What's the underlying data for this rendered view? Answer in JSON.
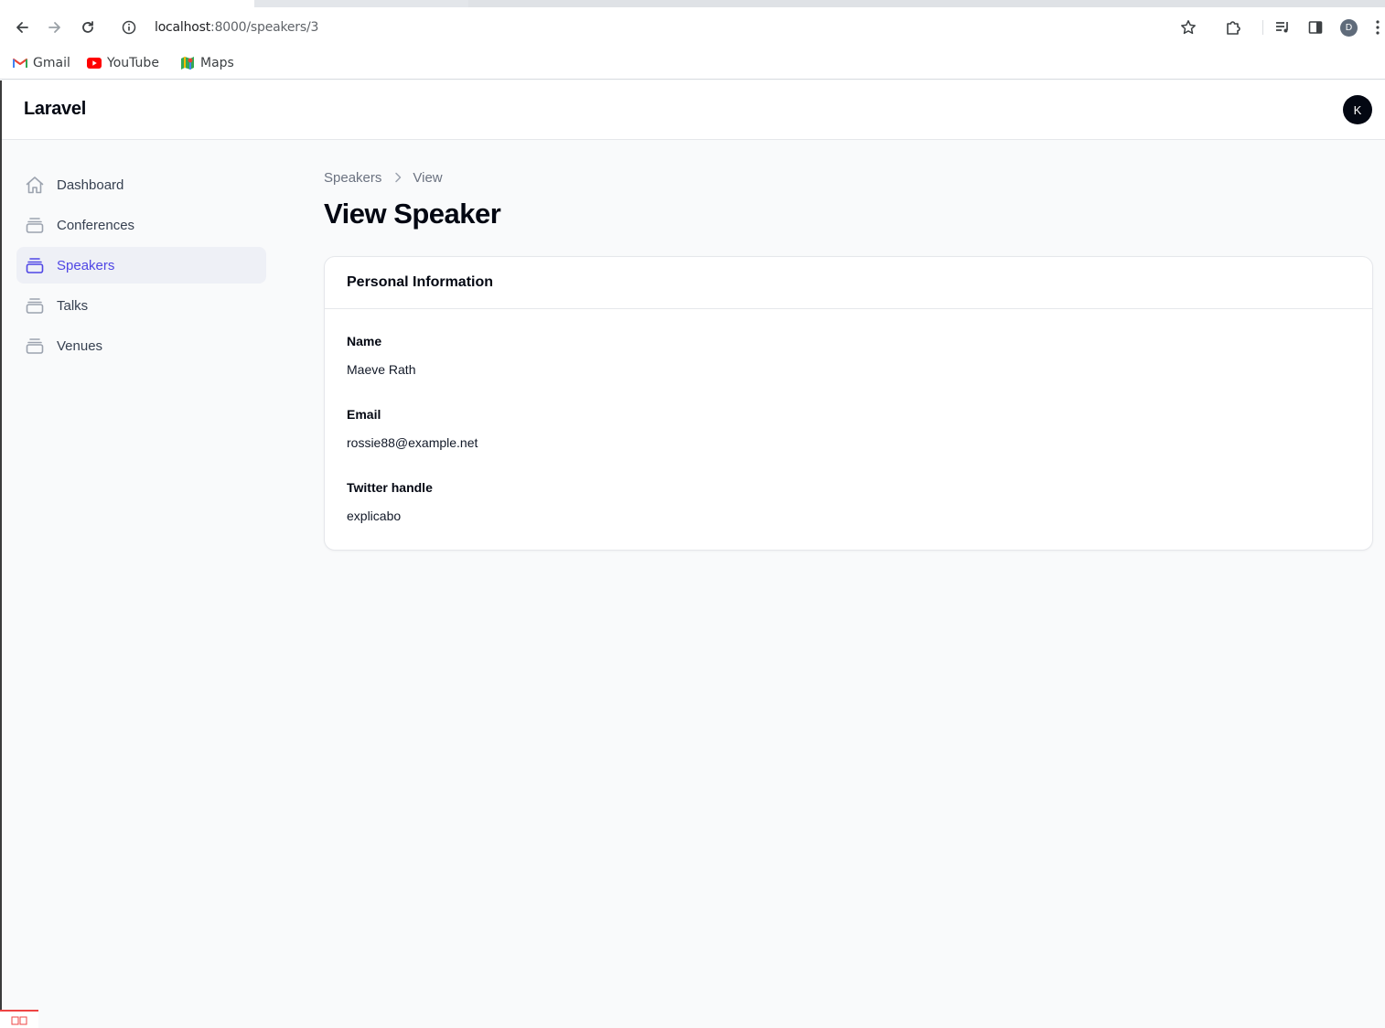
{
  "browser": {
    "url_host": "localhost",
    "url_path": ":8000/speakers/3",
    "bookmarks": [
      {
        "label": "Gmail",
        "icon": "gmail-icon"
      },
      {
        "label": "YouTube",
        "icon": "youtube-icon"
      },
      {
        "label": "Maps",
        "icon": "maps-icon"
      }
    ],
    "profile_initial": "D"
  },
  "app": {
    "brand": "Laravel",
    "user_initial": "K",
    "accent_color": "#4f46e5"
  },
  "sidebar": {
    "items": [
      {
        "label": "Dashboard",
        "icon": "home-icon",
        "active": false
      },
      {
        "label": "Conferences",
        "icon": "collection-icon",
        "active": false
      },
      {
        "label": "Speakers",
        "icon": "collection-icon",
        "active": true
      },
      {
        "label": "Talks",
        "icon": "collection-icon",
        "active": false
      },
      {
        "label": "Venues",
        "icon": "collection-icon",
        "active": false
      }
    ]
  },
  "main": {
    "breadcrumb": [
      "Speakers",
      "View"
    ],
    "title": "View Speaker",
    "section": {
      "title": "Personal Information",
      "fields": [
        {
          "label": "Name",
          "value": "Maeve Rath"
        },
        {
          "label": "Email",
          "value": "rossie88@example.net"
        },
        {
          "label": "Twitter handle",
          "value": "explicabo"
        }
      ]
    }
  }
}
